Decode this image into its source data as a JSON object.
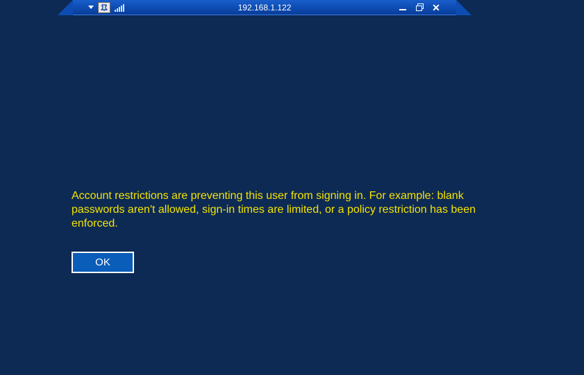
{
  "titlebar": {
    "address": "192.168.1.122"
  },
  "login_error": {
    "message": "Account restrictions are preventing this user from signing in. For example: blank passwords aren't allowed, sign-in times are limited, or a policy restriction has been enforced.",
    "ok_label": "OK"
  }
}
